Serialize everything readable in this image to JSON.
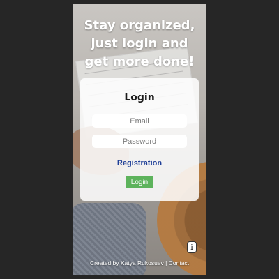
{
  "hero": {
    "headline": "Stay organized, just login and get more done!"
  },
  "login_card": {
    "title": "Login",
    "email_placeholder": "Email",
    "password_placeholder": "Password",
    "registration_link": "Registration",
    "login_button": "Login"
  },
  "info_button": {
    "label": "i",
    "icon": "info-icon"
  },
  "footer": {
    "credit": "Created by Katya Rukosuev",
    "separator": "|",
    "contact": "Contact"
  },
  "colors": {
    "page_background": "#262626",
    "login_button": "#5db35c",
    "link": "#1f3f97"
  }
}
